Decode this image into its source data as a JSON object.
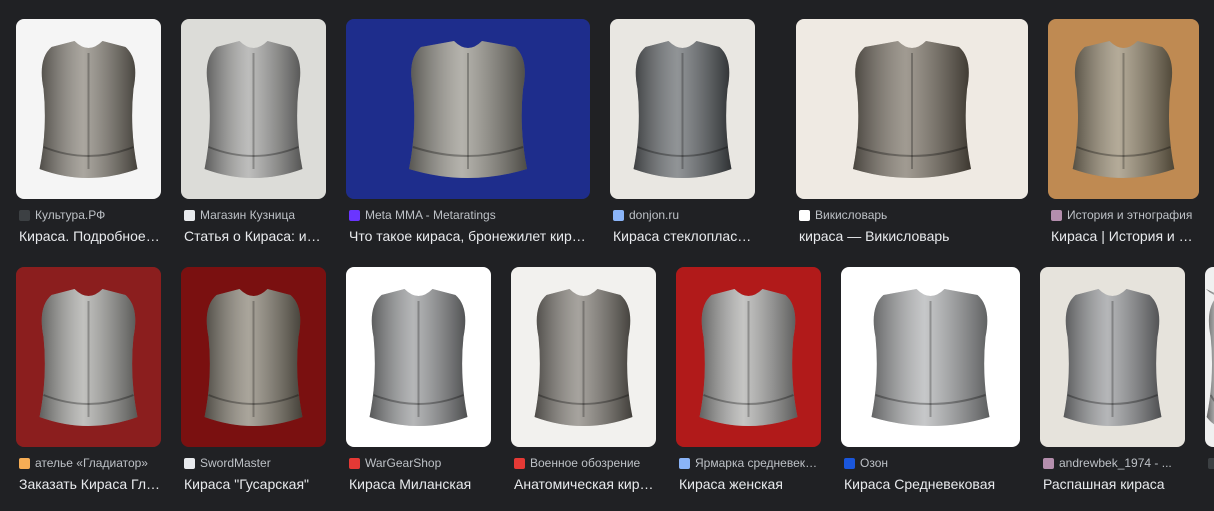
{
  "row1": [
    {
      "source": "Культура.РФ",
      "title": "Кираса. Подробное описание",
      "bg": "#f5f5f5",
      "metal": "#7d776c",
      "favicon": "#3c4043",
      "favicon_icon": "dots-icon"
    },
    {
      "source": "Магазин Кузница",
      "title": "Статья о Кираса: история",
      "bg": "#dcdcd8",
      "metal": "#9a9a98",
      "favicon": "#e8eaed",
      "favicon_icon": "hammer-icon"
    },
    {
      "source": "Meta MMA - Metaratings",
      "title": "Что такое кираса, бронежилет кирасира",
      "bg": "#1e2d8c",
      "metal": "#8d8a80",
      "favicon": "#6a35ff",
      "favicon_icon": "bar-icon"
    },
    {
      "source": "donjon.ru",
      "title": "Кираса стеклопластиковая",
      "bg": "#e9e7e2",
      "metal": "#555a5e",
      "favicon": "#8ab4f8",
      "favicon_icon": "circle-icon"
    },
    {
      "source": "Викисловарь",
      "title": "кираса — Викисловарь",
      "bg": "#efeae3",
      "metal": "#6e6557",
      "favicon": "#ffffff",
      "favicon_icon": "w-icon"
    },
    {
      "source": "История и этнография",
      "title": "Кираса | История и этнография",
      "bg": "#bf8a52",
      "metal": "#8c7e62",
      "favicon": "#b48ead",
      "favicon_icon": "square-icon"
    }
  ],
  "row2": [
    {
      "source": "ателье «Гладиатор»",
      "title": "Заказать Кираса Гладиатор",
      "bg": "#8b1e1e",
      "metal": "#a0a09c",
      "favicon": "#f6ad55",
      "favicon_icon": "square-icon"
    },
    {
      "source": "SwordMaster",
      "title": "Кираса \"Гусарская\"",
      "bg": "#7a1010",
      "metal": "#7c7566",
      "favicon": "#e8eaed",
      "favicon_icon": "sword-icon"
    },
    {
      "source": "WarGearShop",
      "title": "Кираса Миланская",
      "bg": "#ffffff",
      "metal": "#8d8f91",
      "favicon": "#e53935",
      "favicon_icon": "square-icon"
    },
    {
      "source": "Военное обозрение",
      "title": "Анатомическая кираса",
      "bg": "#f2f1ee",
      "metal": "#77726a",
      "favicon": "#e53935",
      "favicon_icon": "star-icon"
    },
    {
      "source": "Ярмарка средневековья",
      "title": "Кираса женская",
      "bg": "#b11a1a",
      "metal": "#a6a6a4",
      "favicon": "#8ab4f8",
      "favicon_icon": "circle-icon"
    },
    {
      "source": "Озон",
      "title": "Кираса Средневековая",
      "bg": "#ffffff",
      "metal": "#a8aaac",
      "favicon": "#1a56db",
      "favicon_icon": "o-icon"
    },
    {
      "source": "andrewbek_1974 - ...",
      "title": "Распашная кираса",
      "bg": "#e6e3dc",
      "metal": "#8d8f92",
      "favicon": "#b48ead",
      "favicon_icon": "square-icon"
    },
    {
      "source": "",
      "title": "",
      "bg": "#f0f0f0",
      "metal": "#999999",
      "favicon": "#3c4043",
      "favicon_icon": "square-icon"
    }
  ]
}
